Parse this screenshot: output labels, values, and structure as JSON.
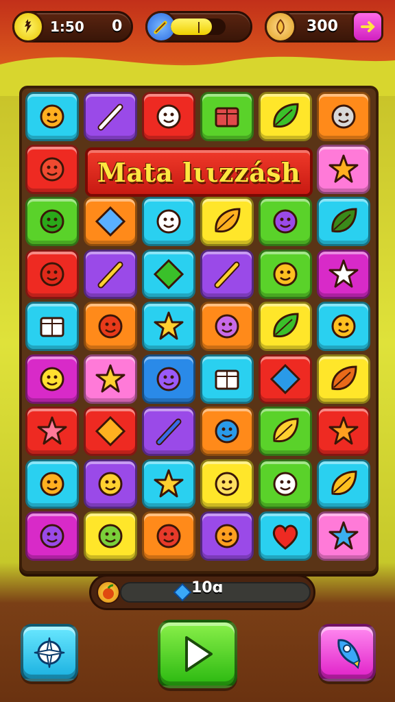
{
  "hud": {
    "timer": "1:50",
    "score": "0",
    "energy_level": 0.75,
    "energy_label": "|",
    "coins": "300"
  },
  "banner": {
    "title": "Mata lιιzzásh"
  },
  "bottom_bar": {
    "value": "10ɑ"
  },
  "colors": {
    "cyan": "#2ad0f0",
    "purple": "#9a4ae8",
    "red": "#ee2a22",
    "green": "#5ad22a",
    "yellow": "#ffe62a",
    "orange": "#ff8a1a",
    "pink": "#ff7ad8",
    "magenta": "#d82ac8",
    "blue": "#2a8ae8"
  },
  "tiles": [
    [
      "cyan:bird-icon",
      "purple:rocket-icon",
      "red:target-icon",
      "green:box-icon",
      "yellow:leaf-icon",
      "orange:cat-icon"
    ],
    [
      "red:ball-icon",
      null,
      null,
      null,
      null,
      "pink:sun-icon"
    ],
    [
      "green:monster-icon",
      "orange:envelope-icon",
      "cyan:pie-icon",
      "yellow:shell-icon",
      "green:blob-icon",
      "cyan:branch-icon"
    ],
    [
      "red:monkey-icon",
      "purple:pen-icon",
      "cyan:kite-icon",
      "purple:tools-icon",
      "green:cat-face-icon",
      "magenta:star-face-icon"
    ],
    [
      "cyan:flag-icon",
      "orange:crab-icon",
      "cyan:star-icon",
      "orange:bug-icon",
      "yellow:leaf-arch-icon",
      "cyan:lion-icon"
    ],
    [
      "magenta:frog-icon",
      "pink:sun-face-icon",
      "blue:squid-icon",
      "cyan:chart-icon",
      "red:key-icon",
      "yellow:hook-icon"
    ],
    [
      "red:flower-icon",
      "red:flame-icon",
      "purple:brush-icon",
      "orange:hook-d-icon",
      "green:leaf-gold-icon",
      "red:sun-red-icon"
    ],
    [
      "cyan:laugh-icon",
      "purple:swirl-icon",
      "cyan:star-gold-icon",
      "yellow:cat-gold-icon",
      "green:ghost-icon",
      "cyan:chat-icon"
    ],
    [
      "magenta:devil-icon",
      "yellow:goblin-icon",
      "orange:dragon-icon",
      "purple:fox-icon",
      "cyan:heart-icon",
      "pink:puffer-icon"
    ]
  ],
  "buttons": {
    "left_icon": "compass-icon",
    "play_icon": "play-icon",
    "right_icon": "rocket-icon"
  }
}
